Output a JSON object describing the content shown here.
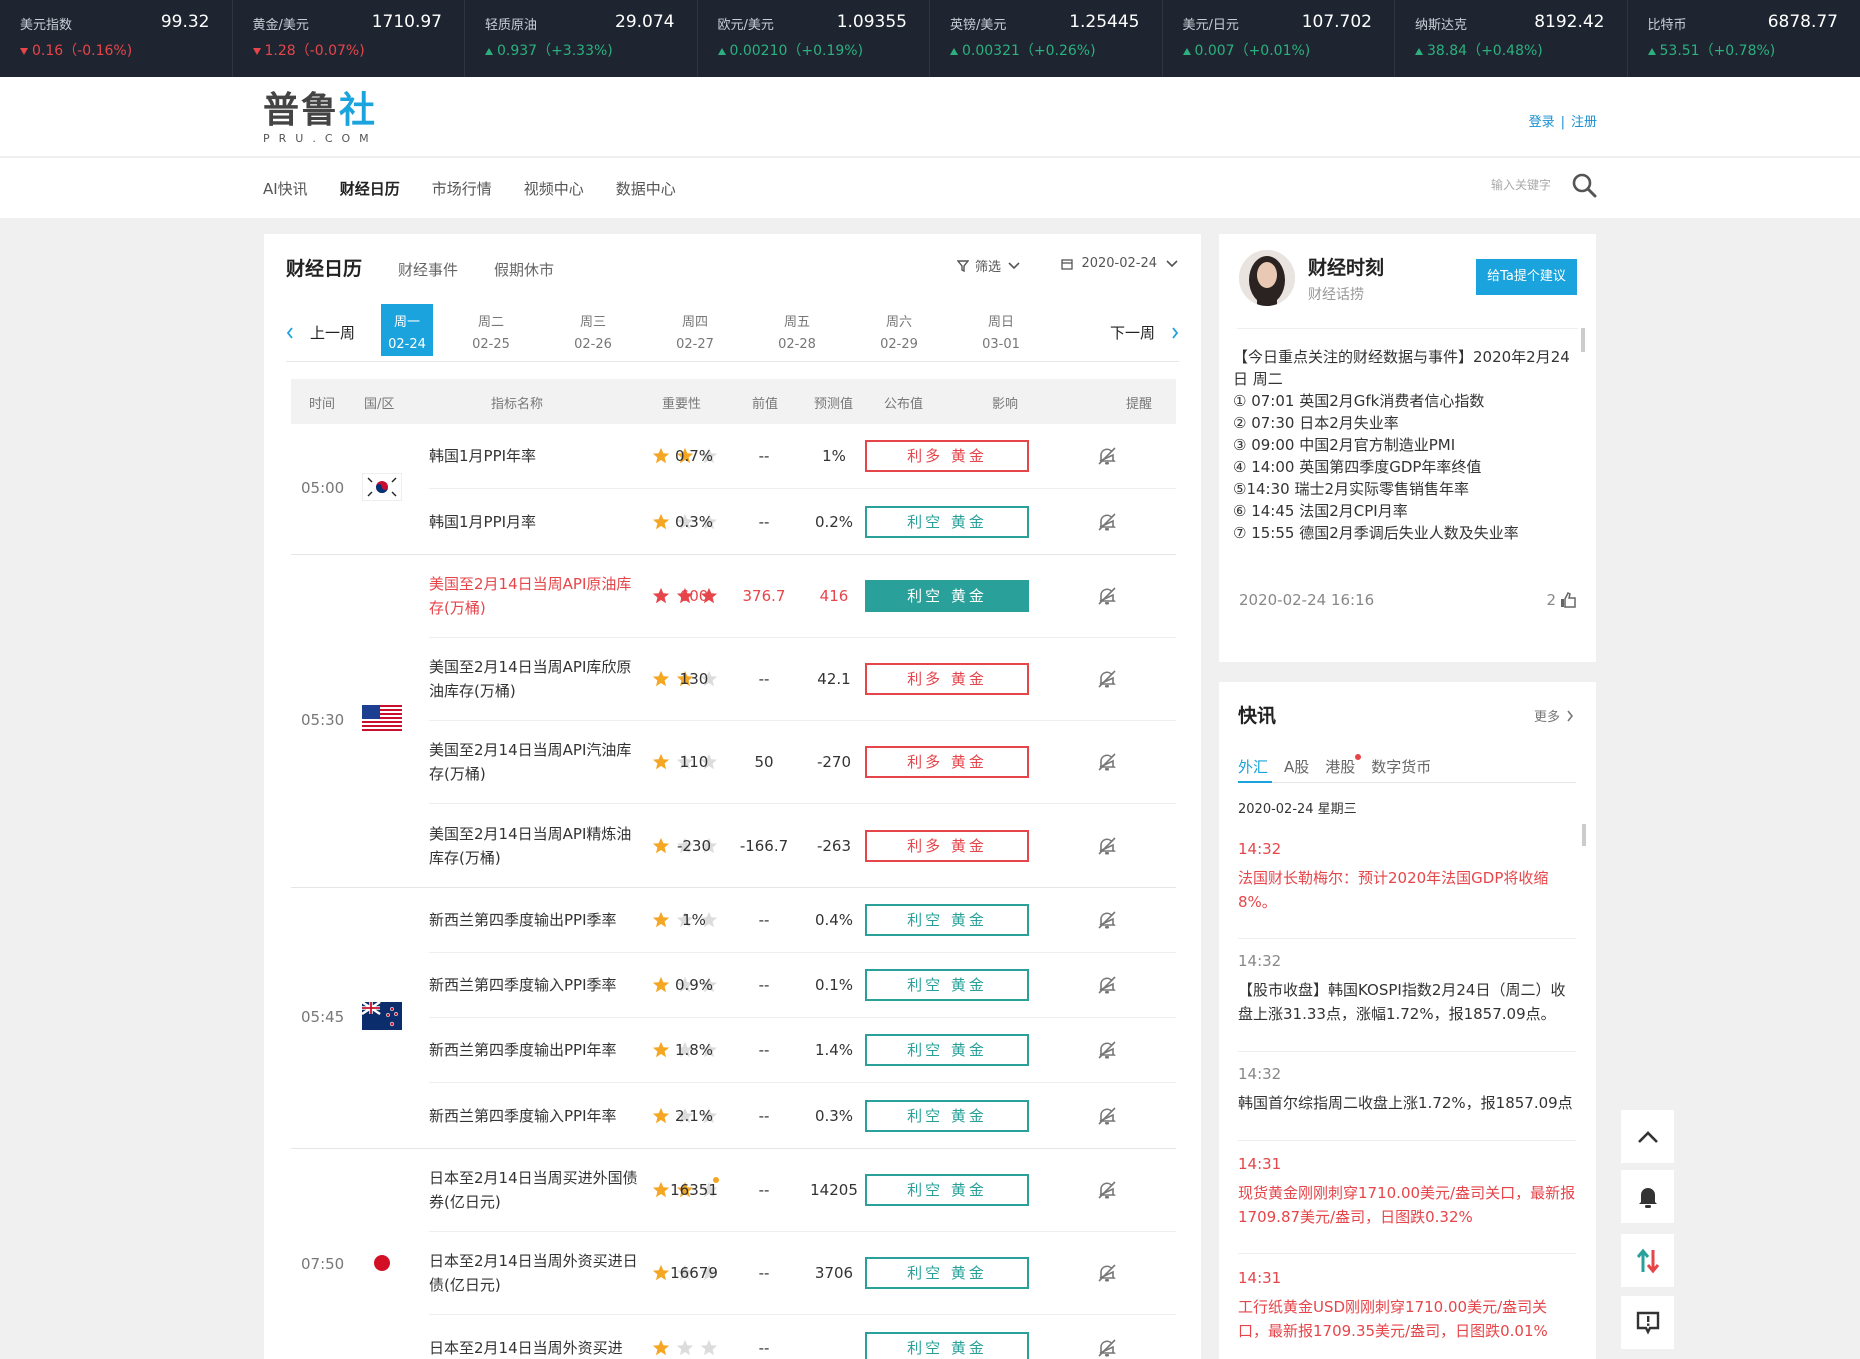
{
  "ticker": [
    {
      "name": "美元指数",
      "value": "99.32",
      "change": "0.16（-0.16%)",
      "dir": "down"
    },
    {
      "name": "黄金/美元",
      "value": "1710.97",
      "change": "1.28（-0.07%)",
      "dir": "down"
    },
    {
      "name": "轻质原油",
      "value": "29.074",
      "change": "0.937（+3.33%)",
      "dir": "up"
    },
    {
      "name": "欧元/美元",
      "value": "1.09355",
      "change": "0.00210（+0.19%)",
      "dir": "up"
    },
    {
      "name": "英镑/美元",
      "value": "1.25445",
      "change": "0.00321（+0.26%)",
      "dir": "up"
    },
    {
      "name": "美元/日元",
      "value": "107.702",
      "change": "0.007（+0.01%)",
      "dir": "up"
    },
    {
      "name": "纳斯达克",
      "value": "8192.42",
      "change": "38.84（+0.48%)",
      "dir": "up"
    },
    {
      "name": "比特币",
      "value": "6878.77",
      "change": "53.51（+0.78%)",
      "dir": "up"
    }
  ],
  "header": {
    "logo_text_a": "普鲁",
    "logo_text_b": "社",
    "logo_sub": "PRU.COM",
    "login": "登录",
    "auth_sep": "|",
    "register": "注册"
  },
  "nav": {
    "items": [
      "AI快讯",
      "财经日历",
      "市场行情",
      "视频中心",
      "数据中心"
    ],
    "active_index": 1,
    "search_placeholder": "输入关键字"
  },
  "main": {
    "title": "财经日历",
    "tabs": [
      "财经事件",
      "假期休市"
    ],
    "filter_label": "筛选",
    "date": "2020-02-24",
    "prev_week": "上一周",
    "next_week": "下一周",
    "days": [
      {
        "wd": "周一",
        "date": "02-24",
        "active": true
      },
      {
        "wd": "周二",
        "date": "02-25"
      },
      {
        "wd": "周三",
        "date": "02-26"
      },
      {
        "wd": "周四",
        "date": "02-27"
      },
      {
        "wd": "周五",
        "date": "02-28"
      },
      {
        "wd": "周六",
        "date": "02-29"
      },
      {
        "wd": "周日",
        "date": "03-01"
      }
    ],
    "columns": [
      "时间",
      "国/区",
      "指标名称",
      "重要性",
      "前值",
      "预测值",
      "公布值",
      "影响",
      "提醒"
    ],
    "groups": [
      {
        "time": "05:00",
        "flag": "kr",
        "rows": [
          {
            "name": "韩国1月PPI年率",
            "stars": 2,
            "prev": "0.7%",
            "fcst": "--",
            "actual": "1%",
            "impact": "利多 黄金",
            "type": "bull"
          },
          {
            "name": "韩国1月PPI月率",
            "stars": 1,
            "prev": "0.3%",
            "fcst": "--",
            "actual": "0.2%",
            "impact": "利空 黄金",
            "type": "bear"
          }
        ]
      },
      {
        "time": "05:30",
        "flag": "us",
        "rows": [
          {
            "name": "美国至2月14日当周API原油库存(万桶)",
            "stars": 3,
            "prev": "600",
            "fcst": "376.7",
            "actual": "416",
            "impact": "利空 黄金",
            "type": "solid",
            "hi": true
          },
          {
            "name": "美国至2月14日当周API库欣原油库存(万桶)",
            "stars": 2,
            "prev": "130",
            "fcst": "--",
            "actual": "42.1",
            "impact": "利多 黄金",
            "type": "bull"
          },
          {
            "name": "美国至2月14日当周API汽油库存(万桶)",
            "stars": 1,
            "prev": "110",
            "fcst": "50",
            "actual": "-270",
            "impact": "利多 黄金",
            "type": "bull"
          },
          {
            "name": "美国至2月14日当周API精炼油库存(万桶)",
            "stars": 1,
            "prev": "-230",
            "fcst": "-166.7",
            "actual": "-263",
            "impact": "利多 黄金",
            "type": "bull"
          }
        ]
      },
      {
        "time": "05:45",
        "flag": "nz",
        "rows": [
          {
            "name": "新西兰第四季度输出PPI季率",
            "stars": 1,
            "prev": "1%",
            "fcst": "--",
            "actual": "0.4%",
            "impact": "利空 黄金",
            "type": "bear"
          },
          {
            "name": "新西兰第四季度输入PPI季率",
            "stars": 1,
            "prev": "0.9%",
            "fcst": "--",
            "actual": "0.1%",
            "impact": "利空 黄金",
            "type": "bear"
          },
          {
            "name": "新西兰第四季度输出PPI年率",
            "stars": 1,
            "prev": "1.8%",
            "fcst": "--",
            "actual": "1.4%",
            "impact": "利空 黄金",
            "type": "bear"
          },
          {
            "name": "新西兰第四季度输入PPI年率",
            "stars": 1,
            "prev": "2.1%",
            "fcst": "--",
            "actual": "0.3%",
            "impact": "利空 黄金",
            "type": "bear"
          }
        ]
      },
      {
        "time": "07:50",
        "flag": "jp",
        "rows": [
          {
            "name": "日本至2月14日当周买进外国债券(亿日元)",
            "stars": 2,
            "prev": "16351",
            "fcst": "--",
            "actual": "14205",
            "impact": "利空 黄金",
            "type": "bear",
            "dot": true
          },
          {
            "name": "日本至2月14日当周外资买进日债(亿日元)",
            "stars": 1,
            "prev": "16679",
            "fcst": "--",
            "actual": "3706",
            "impact": "利空 黄金",
            "type": "bear"
          },
          {
            "name": "日本至2月14日当周外资买进",
            "stars": 1,
            "prev": "",
            "fcst": "--",
            "actual": "",
            "impact": "利空 黄金",
            "type": "bear"
          }
        ]
      }
    ]
  },
  "side1": {
    "title": "财经时刻",
    "subtitle": "财经话捞",
    "suggest": "给Ta提个建议",
    "body": [
      "【今日重点关注的财经数据与事件】2020年2月24日 周二",
      "① 07:01 英国2月Gfk消费者信心指数",
      "② 07:30 日本2月失业率",
      "③ 09:00 中国2月官方制造业PMI",
      "④ 14:00 英国第四季度GDP年率终值",
      "⑤14:30 瑞士2月实际零售销售年率",
      "⑥ 14:45 法国2月CPI月率",
      "⑦ 15:55 德国2月季调后失业人数及失业率"
    ],
    "time": "2020-02-24 16:16",
    "count": "2"
  },
  "side2": {
    "title": "快讯",
    "more": "更多",
    "tabs": [
      "外汇",
      "A股",
      "港股",
      "数字货币"
    ],
    "date": "2020-02-24 星期三",
    "news": [
      {
        "time": "14:32",
        "text": "法国财长勒梅尔：预计2020年法国GDP将收缩8%。",
        "red": true
      },
      {
        "time": "14:32",
        "text": "【股市收盘】韩国KOSPI指数2月24日（周二）收盘上涨31.33点，涨幅1.72%，报1857.09点。",
        "red": false
      },
      {
        "time": "14:32",
        "text": "韩国首尔综指周二收盘上涨1.72%，报1857.09点",
        "red": false
      },
      {
        "time": "14:31",
        "text": "现货黄金刚刚刺穿1710.00美元/盎司关口，最新报1709.87美元/盎司，日图跌0.32%",
        "red": true
      },
      {
        "time": "14:31",
        "text": "工行纸黄金USD刚刚刺穿1710.00美元/盎司关口，最新报1709.35美元/盎司，日图跌0.01%",
        "red": true
      }
    ]
  },
  "colors": {
    "accent": "#1aa3dc",
    "bull": "#e6454a",
    "bear": "#2aa09a",
    "star": "#f5a623"
  }
}
